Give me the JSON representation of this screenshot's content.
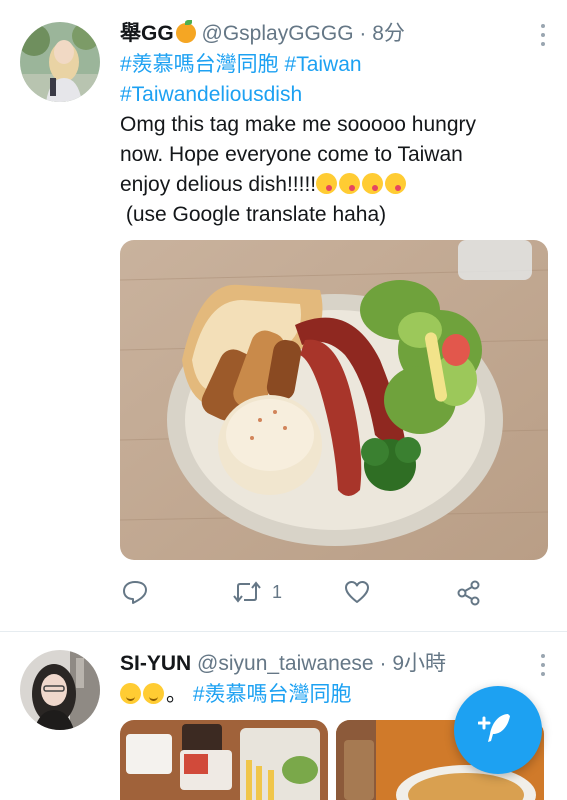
{
  "tweets": [
    {
      "display_name": "舉GG",
      "handle": "@GsplayGGGG",
      "separator": "·",
      "time": "8分",
      "hashtags": [
        "#羨慕嗎台灣同胞",
        "#Taiwan",
        "#Taiwandeliousdish"
      ],
      "text_lines": [
        "Omg this tag make me sooooo hungry",
        "now. Hope everyone come to Taiwan",
        "enjoy delious dish!!!!!",
        " (use Google translate haha)"
      ],
      "emoji_icons": [
        "face-savoring-food",
        "face-savoring-food",
        "face-savoring-food",
        "face-savoring-food"
      ],
      "header_emoji": "tangerine",
      "retweet_count": "1",
      "icons": [
        "reply-icon",
        "retweet-icon",
        "like-icon",
        "share-icon"
      ]
    },
    {
      "display_name": "SI-YUN",
      "handle": "@siyun_taiwanese",
      "separator": "·",
      "time": "9小時",
      "text_suffix": "。",
      "hashtags": [
        "#羨慕嗎台灣同胞"
      ],
      "emoji_icons": [
        "relieved-face",
        "relieved-face"
      ]
    }
  ],
  "fab": {
    "icon": "compose-tweet-icon",
    "color": "#1da1f2"
  },
  "colors": {
    "link": "#1da1f2",
    "secondary_text": "#657786",
    "primary_text": "#14171a"
  }
}
